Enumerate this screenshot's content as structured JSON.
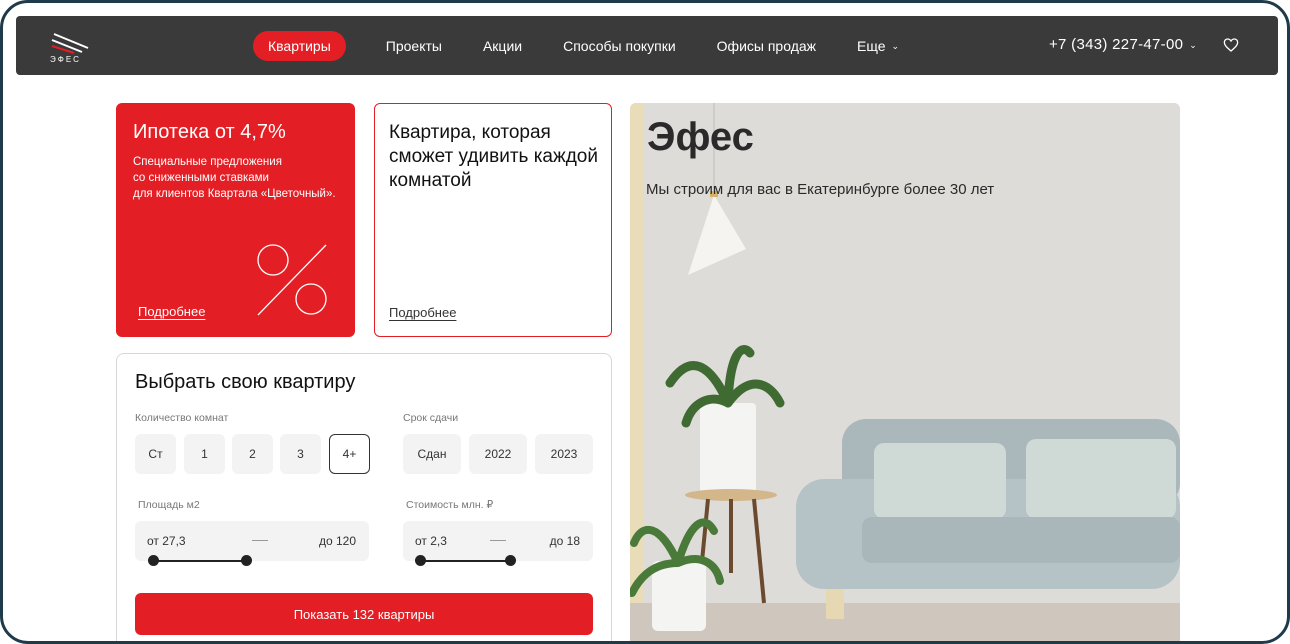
{
  "header": {
    "logo_text": "ЭФЕС",
    "nav": [
      "Квартиры",
      "Проекты",
      "Акции",
      "Способы покупки",
      "Офисы продаж",
      "Еще"
    ],
    "phone": "+7 (343) 227-47-00"
  },
  "promo_card": {
    "title": "Ипотека от 4,7%",
    "lines": [
      "Специальные предложения",
      "со сниженными ставками",
      "для клиентов Квартала «Цветочный»."
    ],
    "link": "Подробнее"
  },
  "info_card": {
    "title": "Квартира, которая сможет удивить каждой комнатой",
    "link": "Подробнее"
  },
  "filter": {
    "title": "Выбрать свою квартиру",
    "rooms_label": "Количество комнат",
    "rooms": [
      "Ст",
      "1",
      "2",
      "3",
      "4+"
    ],
    "rooms_selected": "4+",
    "deadline_label": "Срок сдачи",
    "deadlines": [
      "Сдан",
      "2022",
      "2023"
    ],
    "area_label": "Площадь м2",
    "area_from": "от  27,3",
    "area_to": "до  120",
    "price_label": "Стоимость млн. ₽",
    "price_from": "от  2,3",
    "price_to": "до  18",
    "button": "Показать 132 квартиры"
  },
  "hero": {
    "title": "Эфес",
    "tagline": "Мы строим для вас в Екатеринбурге более 30 лет"
  },
  "colors": {
    "accent": "#e31e24",
    "header_bg": "#3a3a3a"
  }
}
